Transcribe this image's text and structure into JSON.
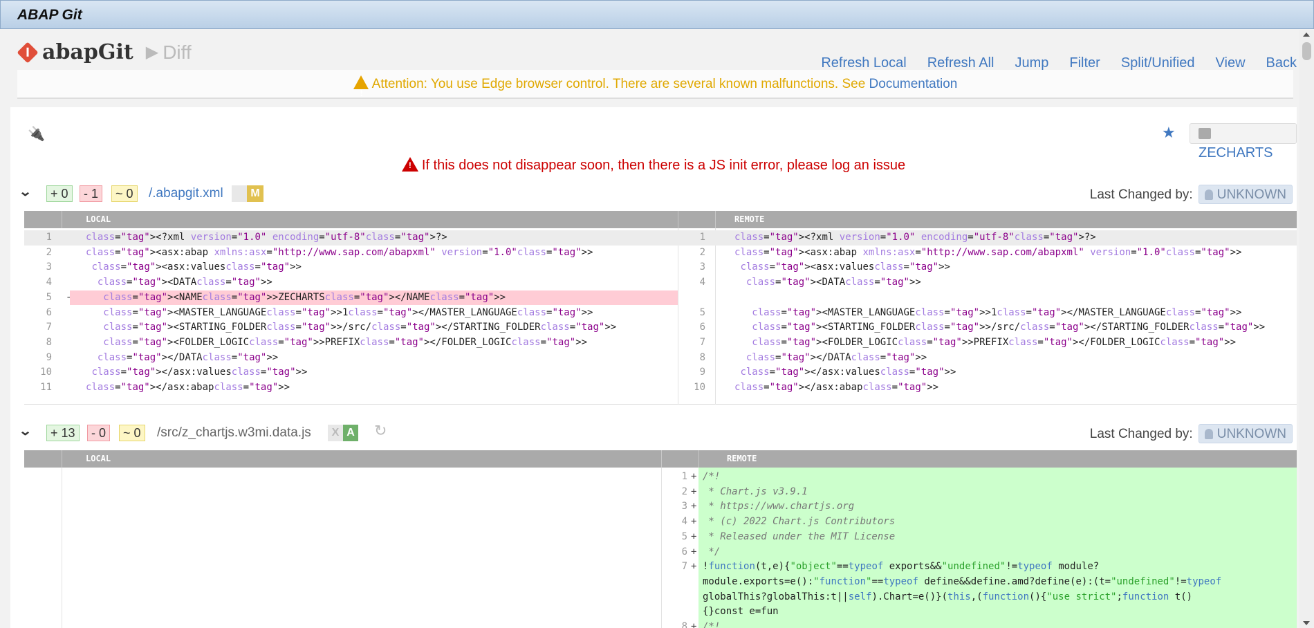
{
  "window": {
    "title": "ABAP Git"
  },
  "header": {
    "app_name": "abapGit",
    "breadcrumb": "Diff",
    "menu": [
      "Refresh Local",
      "Refresh All",
      "Jump",
      "Filter",
      "Split/Unified",
      "View",
      "Back"
    ]
  },
  "attention": {
    "text": "Attention: You use Edge browser control. There are several known malfunctions. See ",
    "link": "Documentation"
  },
  "toolbar": {
    "plug_icon": "plug-icon",
    "favorite_icon": "star-icon",
    "package": "ZECHARTS"
  },
  "js_error": "If this does not disappear soon, then there is a JS init error, please log an issue",
  "labels": {
    "local": "LOCAL",
    "remote": "REMOTE",
    "last_changed_by": "Last Changed by:",
    "user": "UNKNOWN"
  },
  "files": [
    {
      "added": "+ 0",
      "deleted": "- 1",
      "modified": "~ 0",
      "name": "/.abapgit.xml",
      "state_local": "",
      "state_remote": "M"
    },
    {
      "added": "+ 13",
      "deleted": "- 0",
      "modified": "~ 0",
      "name": "/src/z_chartjs.w3mi.data.js",
      "state_local": "X",
      "state_remote": "A"
    }
  ],
  "file1_lines": [
    {
      "ln": "1",
      "rn": "1",
      "l": "<?xml version=\"1.0\" encoding=\"utf-8\"?>",
      "r": "<?xml version=\"1.0\" encoding=\"utf-8\"?>"
    },
    {
      "ln": "2",
      "rn": "2",
      "l": "<asx:abap xmlns:asx=\"http://www.sap.com/abapxml\" version=\"1.0\">",
      "r": "<asx:abap xmlns:asx=\"http://www.sap.com/abapxml\" version=\"1.0\">"
    },
    {
      "ln": "3",
      "rn": "3",
      "l": " <asx:values>",
      "r": " <asx:values>"
    },
    {
      "ln": "4",
      "rn": "4",
      "l": "  <DATA>",
      "r": "  <DATA>"
    },
    {
      "ln": "5",
      "rn": "",
      "sign": "-",
      "l": "   <NAME>ZECHARTS</NAME>",
      "r": ""
    },
    {
      "ln": "6",
      "rn": "5",
      "l": "   <MASTER_LANGUAGE>1</MASTER_LANGUAGE>",
      "r": "   <MASTER_LANGUAGE>1</MASTER_LANGUAGE>"
    },
    {
      "ln": "7",
      "rn": "6",
      "l": "   <STARTING_FOLDER>/src/</STARTING_FOLDER>",
      "r": "   <STARTING_FOLDER>/src/</STARTING_FOLDER>"
    },
    {
      "ln": "8",
      "rn": "7",
      "l": "   <FOLDER_LOGIC>PREFIX</FOLDER_LOGIC>",
      "r": "   <FOLDER_LOGIC>PREFIX</FOLDER_LOGIC>"
    },
    {
      "ln": "9",
      "rn": "8",
      "l": "  </DATA>",
      "r": "  </DATA>"
    },
    {
      "ln": "10",
      "rn": "9",
      "l": " </asx:values>",
      "r": " </asx:values>"
    },
    {
      "ln": "11",
      "rn": "10",
      "l": "</asx:abap>",
      "r": "</asx:abap>"
    }
  ],
  "file2_lines": [
    {
      "rn": "1",
      "r": "/*!"
    },
    {
      "rn": "2",
      "r": " * Chart.js v3.9.1"
    },
    {
      "rn": "3",
      "r": " * https://www.chartjs.org"
    },
    {
      "rn": "4",
      "r": " * (c) 2022 Chart.js Contributors"
    },
    {
      "rn": "5",
      "r": " * Released under the MIT License"
    },
    {
      "rn": "6",
      "r": " */"
    },
    {
      "rn": "7",
      "r": "!function(t,e){\"object\"==typeof exports&&\"undefined\"!=typeof module?"
    },
    {
      "rn": "",
      "r": "module.exports=e():\"function\"==typeof define&&define.amd?define(e):(t=\"undefined\"!=typeof"
    },
    {
      "rn": "",
      "r": "globalThis?globalThis:t||self).Chart=e()}(this,(function(){\"use strict\";function t()"
    },
    {
      "rn": "",
      "r": "{}const e=fun"
    },
    {
      "rn": "8",
      "r": "/*!"
    }
  ],
  "colors": {
    "accent": "#4078c0",
    "warning": "#e0a800",
    "error": "#cc0000",
    "added_bg": "#ccffcc",
    "deleted_bg": "#ffccd5"
  }
}
